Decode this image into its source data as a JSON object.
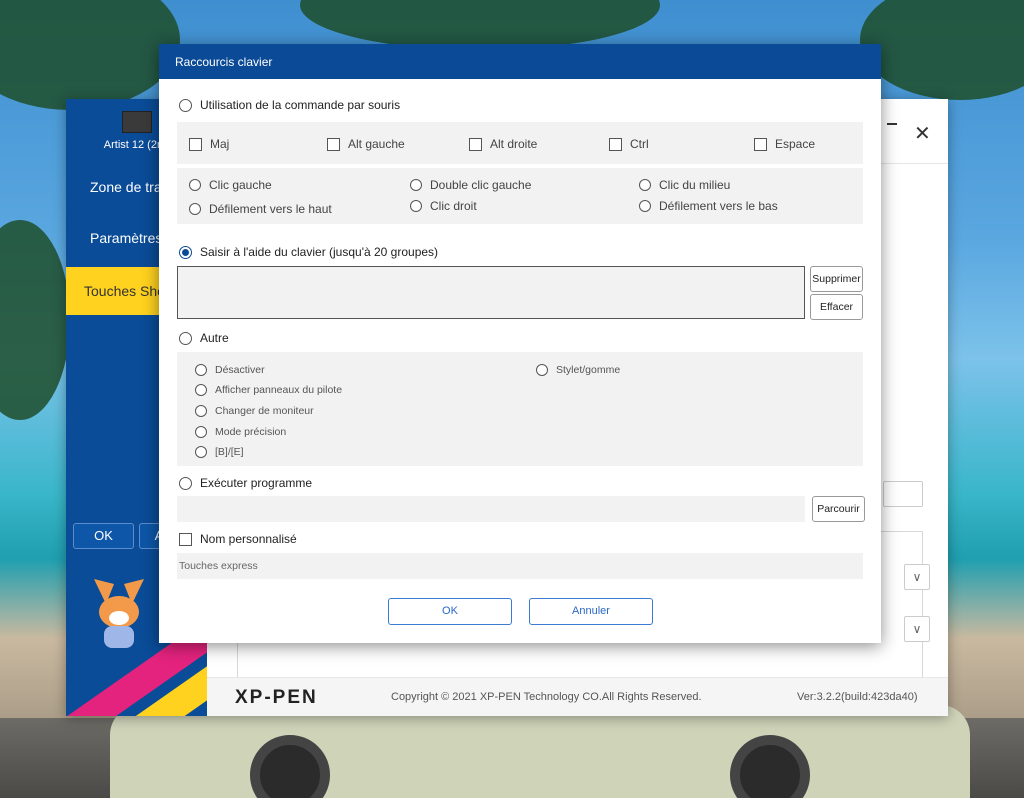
{
  "app": {
    "device_name": "Artist 12 (2nd",
    "sidebar_items": [
      "Zone de tra",
      "Paramètres d",
      "Touches Sho"
    ],
    "ok_label": "OK",
    "apply_fragment": "A",
    "brand": "XP-PEN",
    "copyright": "Copyright © 2021 XP-PEN Technology CO.All Rights Reserved.",
    "version": "Ver:3.2.2(build:423da40)",
    "chevron": "∨"
  },
  "dialog": {
    "title": "Raccourcis clavier",
    "mouse_section": {
      "label": "Utilisation de la commande par souris",
      "selected": false,
      "modifiers": [
        {
          "label": "Maj",
          "checked": false
        },
        {
          "label": "Alt gauche",
          "checked": false
        },
        {
          "label": "Alt droite",
          "checked": false
        },
        {
          "label": "Ctrl",
          "checked": false
        },
        {
          "label": "Espace",
          "checked": false
        }
      ],
      "actions": [
        {
          "label": "Clic gauche"
        },
        {
          "label": "Défilement vers le haut"
        },
        {
          "label": "Double clic gauche"
        },
        {
          "label": "Clic droit"
        },
        {
          "label": "Clic du milieu"
        },
        {
          "label": "Défilement vers le bas"
        }
      ]
    },
    "keyboard_section": {
      "label": "Saisir à l'aide du clavier (jusqu'à 20 groupes)",
      "selected": true,
      "value": "",
      "delete_label": "Supprimer",
      "clear_label": "Effacer"
    },
    "other_section": {
      "label": "Autre",
      "selected": false,
      "options": [
        "Désactiver",
        "Afficher panneaux du pilote",
        "Changer de moniteur",
        "Mode précision",
        "[B]/[E]",
        "Stylet/gomme"
      ]
    },
    "program_section": {
      "label": "Exécuter programme",
      "selected": false,
      "value": "",
      "browse_label": "Parcourir"
    },
    "custom_name": {
      "label": "Nom personnalisé",
      "checked": false,
      "value": "Touches express"
    },
    "ok_label": "OK",
    "cancel_label": "Annuler"
  }
}
